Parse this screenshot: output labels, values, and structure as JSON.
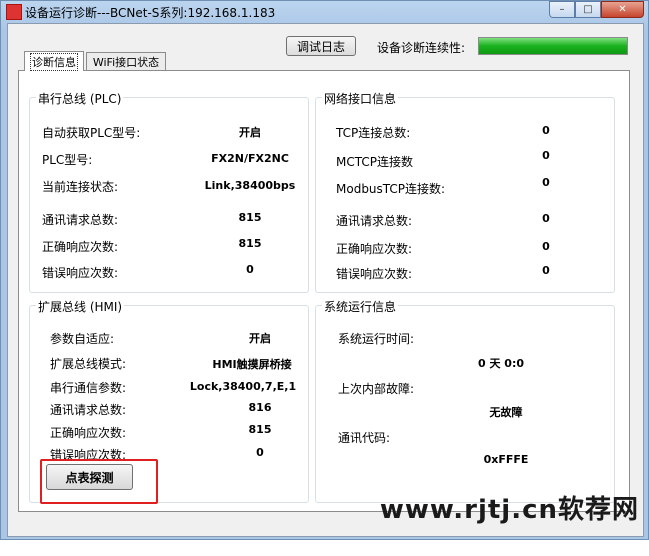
{
  "window": {
    "title": "设备运行诊断---BCNet-S系列:192.168.1.183",
    "buttons": {
      "minimize": "–",
      "maximize": "□",
      "close": "✕"
    }
  },
  "toolbar": {
    "log_button": "调试日志",
    "continuity_label": "设备诊断连续性:",
    "continuity_level": 1.0,
    "continuity_color": "#19b11d"
  },
  "tabs": [
    {
      "label": "诊断信息",
      "active": true
    },
    {
      "label": "WiFi接口状态",
      "active": false
    }
  ],
  "serial_bus": {
    "title": "串行总线 (PLC)",
    "rows": [
      {
        "label": "自动获取PLC型号:",
        "value": "开启"
      },
      {
        "label": "PLC型号:",
        "value": "FX2N/FX2NC"
      },
      {
        "label": "当前连接状态:",
        "value": "Link,38400bps"
      },
      {
        "label": "通讯请求总数:",
        "value": "815"
      },
      {
        "label": "正确响应次数:",
        "value": "815"
      },
      {
        "label": "错误响应次数:",
        "value": "0"
      }
    ]
  },
  "network": {
    "title": "网络接口信息",
    "rows": [
      {
        "label": "TCP连接总数:",
        "value": "0"
      },
      {
        "label": "MCTCP连接数",
        "value": "0"
      },
      {
        "label": "ModbusTCP连接数:",
        "value": "0"
      },
      {
        "label": "通讯请求总数:",
        "value": "0"
      },
      {
        "label": "正确响应次数:",
        "value": "0"
      },
      {
        "label": "错误响应次数:",
        "value": "0"
      }
    ]
  },
  "ext_bus": {
    "title": "扩展总线 (HMI)",
    "rows": [
      {
        "label": "参数自适应:",
        "value": "开启"
      },
      {
        "label": "扩展总线模式:",
        "value": "HMI触摸屏桥接"
      },
      {
        "label": "串行通信参数:",
        "value": "Lock,38400,7,E,1"
      },
      {
        "label": "通讯请求总数:",
        "value": "816"
      },
      {
        "label": "正确响应次数:",
        "value": "815"
      },
      {
        "label": "错误响应次数:",
        "value": "0"
      }
    ],
    "probe_button": "点表探测"
  },
  "system": {
    "title": "系统运行信息",
    "uptime_label": "系统运行时间:",
    "uptime_value": "0 天 0:0",
    "last_fault_label": "上次内部故障:",
    "last_fault_value": "无故障",
    "code_label": "通讯代码:",
    "code_value": "0xFFFE"
  },
  "watermark": "www.rjtj.cn软荐网",
  "highlight_color": "#e02020"
}
